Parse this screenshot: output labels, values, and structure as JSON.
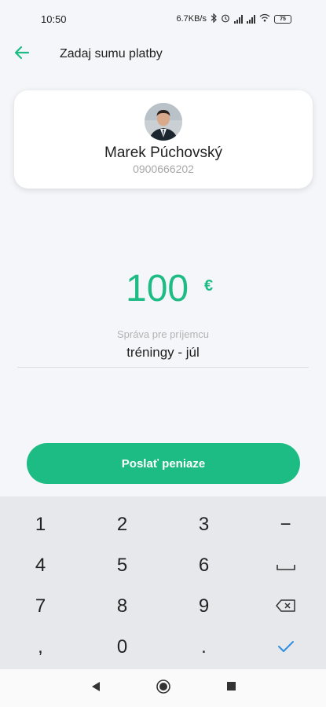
{
  "status_bar": {
    "time": "10:50",
    "speed": "6.7KB/s",
    "battery": "75",
    "icons": [
      "bluetooth-icon",
      "alarm-icon",
      "signal-icon",
      "signal-icon",
      "wifi-icon",
      "battery-icon"
    ]
  },
  "header": {
    "title": "Zadaj sumu platby",
    "back_icon": "arrow-left-icon"
  },
  "recipient": {
    "name": "Marek Púchovský",
    "phone": "0900666202",
    "avatar": "avatar-photo"
  },
  "payment": {
    "amount": "100",
    "currency": "€",
    "message_label": "Správa pre príjemcu",
    "message_value": "tréningy - júl"
  },
  "send_button": {
    "label": "Poslať peniaze"
  },
  "keypad": {
    "keys": [
      {
        "label": "1",
        "icon": ""
      },
      {
        "label": "2",
        "icon": ""
      },
      {
        "label": "3",
        "icon": ""
      },
      {
        "label": "−",
        "icon": ""
      },
      {
        "label": "4",
        "icon": ""
      },
      {
        "label": "5",
        "icon": ""
      },
      {
        "label": "6",
        "icon": ""
      },
      {
        "label": "",
        "icon": "space-icon"
      },
      {
        "label": "7",
        "icon": ""
      },
      {
        "label": "8",
        "icon": ""
      },
      {
        "label": "9",
        "icon": ""
      },
      {
        "label": "",
        "icon": "backspace-icon"
      },
      {
        "label": ",",
        "icon": ""
      },
      {
        "label": "0",
        "icon": ""
      },
      {
        "label": ".",
        "icon": ""
      },
      {
        "label": "",
        "icon": "checkmark-icon"
      }
    ]
  },
  "nav_bar": {
    "icons": [
      "back-triangle-icon",
      "home-circle-icon",
      "recents-square-icon"
    ]
  },
  "colors": {
    "accent": "#1ebc85",
    "background": "#f4f6f9",
    "keypad_bg": "#e6e8ec",
    "check_blue": "#2f8fe0"
  }
}
